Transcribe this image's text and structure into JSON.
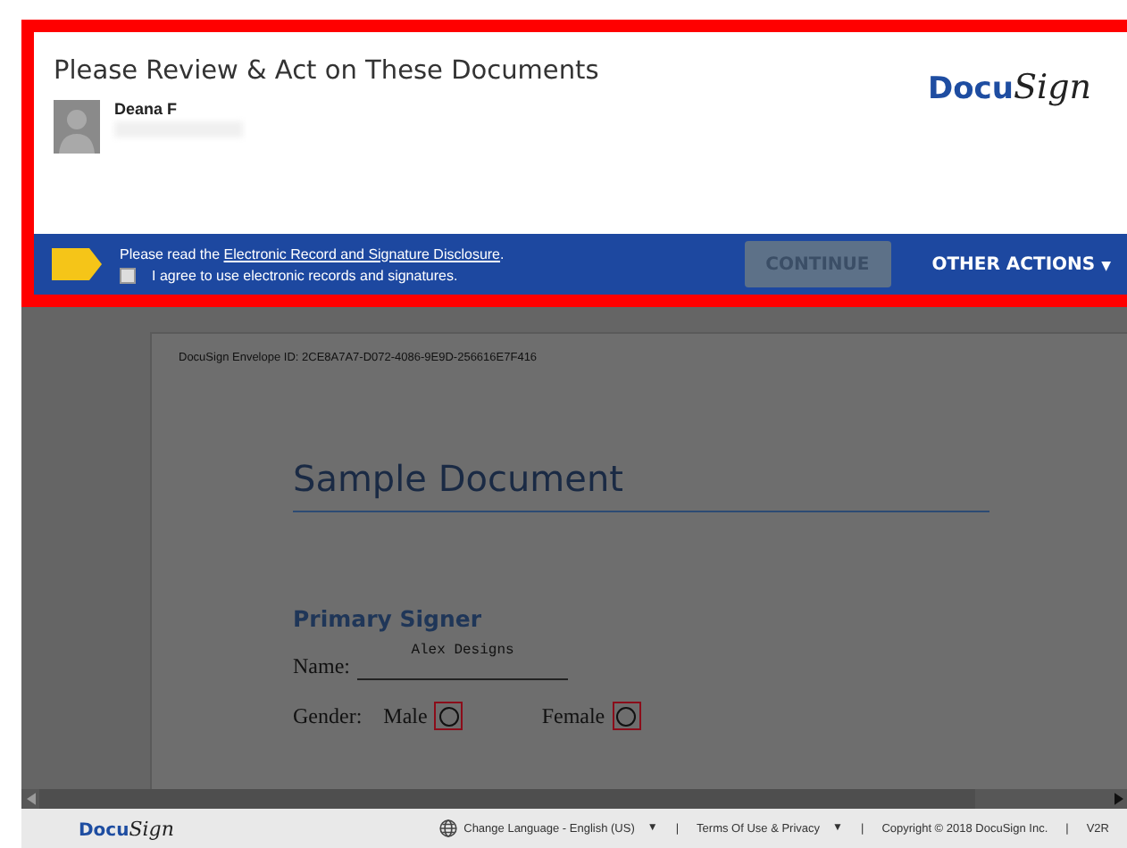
{
  "header": {
    "title": "Please Review & Act on These Documents",
    "logo": {
      "part_1": "Docu",
      "part_2": "Sign"
    },
    "user": {
      "name": "Deana F",
      "email_redacted": true
    }
  },
  "action_bar": {
    "notice_prefix": "Please read the ",
    "notice_link": "Electronic Record and Signature Disclosure",
    "notice_suffix": ".",
    "agree": {
      "label": "I agree to use electronic records and signatures.",
      "checked": false
    },
    "continue": {
      "label": "CONTINUE",
      "disabled": true
    },
    "other_actions": {
      "label": "OTHER ACTIONS",
      "caret": "▼"
    }
  },
  "document": {
    "envelope_id": "DocuSign Envelope ID: 2CE8A7A7-D072-4086-9E9D-256616E7F416",
    "title": "Sample Document",
    "section": "Primary Signer",
    "name_label": "Name:",
    "name_value": "Alex Designs",
    "gender_label": "Gender:",
    "options": [
      {
        "label": "Male",
        "checked": false
      },
      {
        "label": "Female",
        "checked": false
      }
    ]
  },
  "footer": {
    "logo": {
      "part_1": "Docu",
      "part_2": "Sign"
    },
    "language": "Change Language - English (US)",
    "terms": "Terms Of Use & Privacy",
    "copyright": "Copyright © 2018 DocuSign Inc.",
    "version": "V2R",
    "caret": "▼",
    "separator": "|"
  }
}
